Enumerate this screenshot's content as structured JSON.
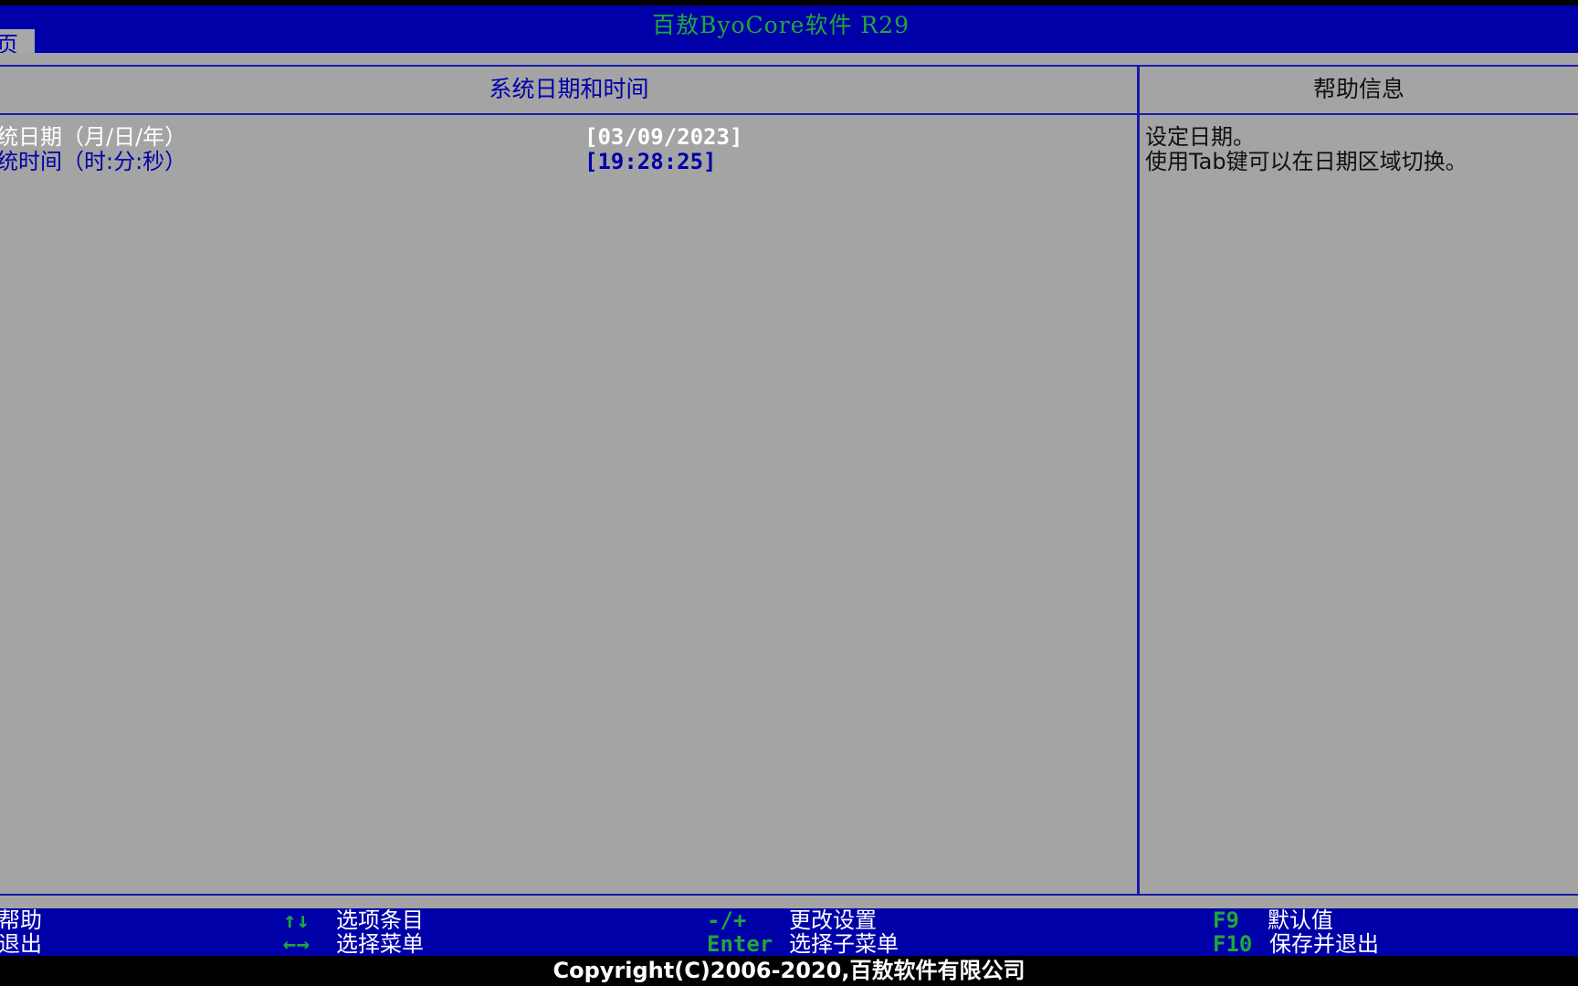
{
  "header": {
    "title": "百敖ByoCore软件 R29",
    "active_tab": "页"
  },
  "left_panel": {
    "title": "系统日期和时间",
    "items": [
      {
        "label": "统日期（月/日/年）",
        "value": "[03/09/2023]"
      },
      {
        "label": "统时间（时:分:秒）",
        "value": "[19:28:25]"
      }
    ]
  },
  "help_panel": {
    "title": "帮助信息",
    "lines": [
      "设定日期。",
      "使用Tab键可以在日期区域切换。"
    ]
  },
  "footer": {
    "help_desc": "帮助",
    "exit_desc": "退出",
    "updown_key": "↑↓",
    "updown_desc": "选项条目",
    "leftright_key": "←→",
    "leftright_desc": "选择菜单",
    "change_key": "-/+",
    "change_desc": "更改设置",
    "enter_key": "Enter",
    "enter_desc": "选择子菜单",
    "f9_key": "F9",
    "f9_desc": "默认值",
    "f10_key": "F10",
    "f10_desc": "保存并退出"
  },
  "copyright": "Copyright(C)2006-2020,百敖软件有限公司",
  "colors": {
    "title_bg": "#0000a8",
    "body_bg": "#a4a4a4",
    "key_green": "#1fa83a",
    "selected_text": "#ffffff"
  }
}
